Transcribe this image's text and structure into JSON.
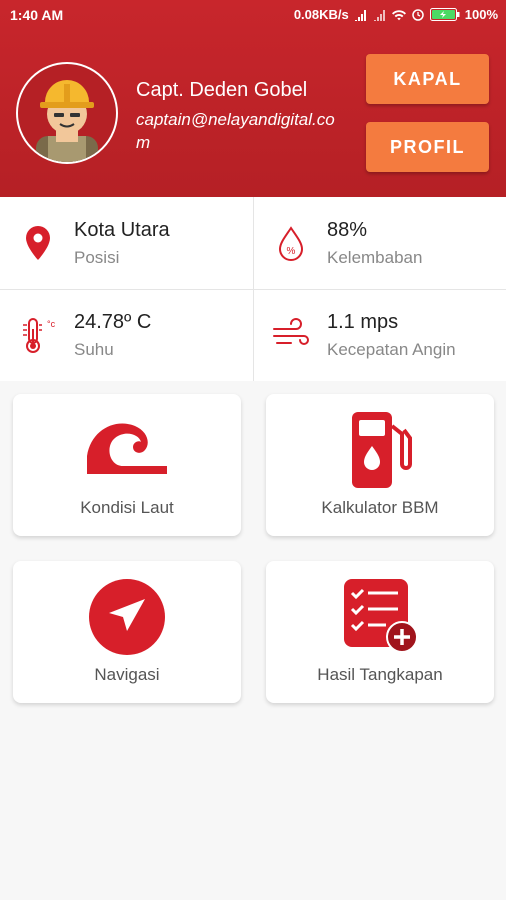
{
  "status_bar": {
    "time": "1:40 AM",
    "speed": "0.08KB/s",
    "battery": "100%"
  },
  "profile": {
    "name": "Capt. Deden Gobel",
    "email": "captain@nelayandigital.com"
  },
  "buttons": {
    "kapal": "KAPAL",
    "profil": "PROFIL"
  },
  "info": {
    "location": {
      "value": "Kota Utara",
      "label": "Posisi"
    },
    "humidity": {
      "value": "88%",
      "label": "Kelembaban"
    },
    "temperature": {
      "value": "24.78º C",
      "label": "Suhu"
    },
    "wind": {
      "value": "1.1 mps",
      "label": "Kecepatan Angin"
    }
  },
  "menu": {
    "kondisi_laut": "Kondisi Laut",
    "kalkulator_bbm": "Kalkulator BBM",
    "navigasi": "Navigasi",
    "hasil_tangkapan": "Hasil Tangkapan"
  },
  "colors": {
    "primary": "#c8262c",
    "accent": "#f47b3f",
    "icon_red": "#d71f2a"
  }
}
